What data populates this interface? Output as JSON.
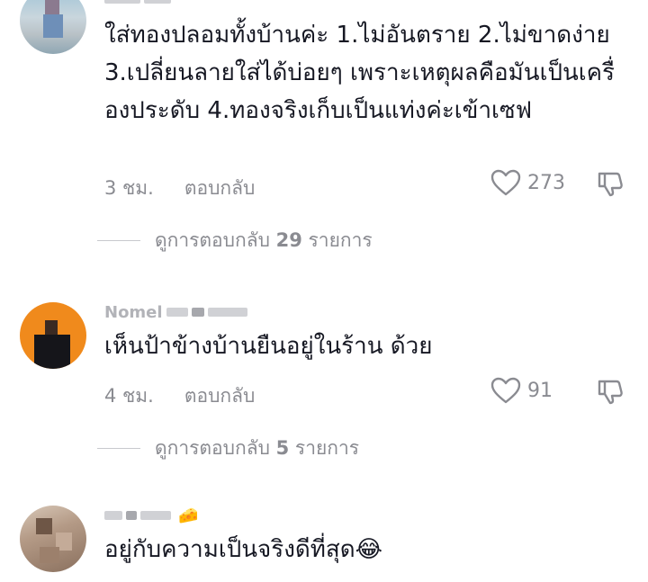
{
  "comments": [
    {
      "username": "",
      "text": "ใส่ทองปลอมทั้งบ้านค่ะ 1.ไม่อันตราย 2.ไม่ขาดง่าย 3.เปลี่ยนลายใส่ได้บ่อยๆ เพราะเหตุผลคือมันเป็นเครื่องประดับ 4.ทองจริงเก็บเป็นแท่งค่ะเข้าเซฟ",
      "time": "3 ชม.",
      "reply_label": "ตอบกลับ",
      "likes": "273",
      "view_replies_prefix": "ดูการตอบกลับ",
      "reply_count": "29",
      "view_replies_suffix": "รายการ"
    },
    {
      "username": "Nomel",
      "text": "เห็นป้าข้างบ้านยืนอยู่ในร้าน ด้วย",
      "time": "4 ชม.",
      "reply_label": "ตอบกลับ",
      "likes": "91",
      "view_replies_prefix": "ดูการตอบกลับ",
      "reply_count": "5",
      "view_replies_suffix": "รายการ"
    },
    {
      "username": "",
      "text": "อยู่กับความเป็นจริงดีที่สุด😂",
      "username_emoji": "🧀"
    }
  ],
  "icons": [
    "heart-icon",
    "thumbs-down-icon",
    "cheese-emoji-icon"
  ]
}
